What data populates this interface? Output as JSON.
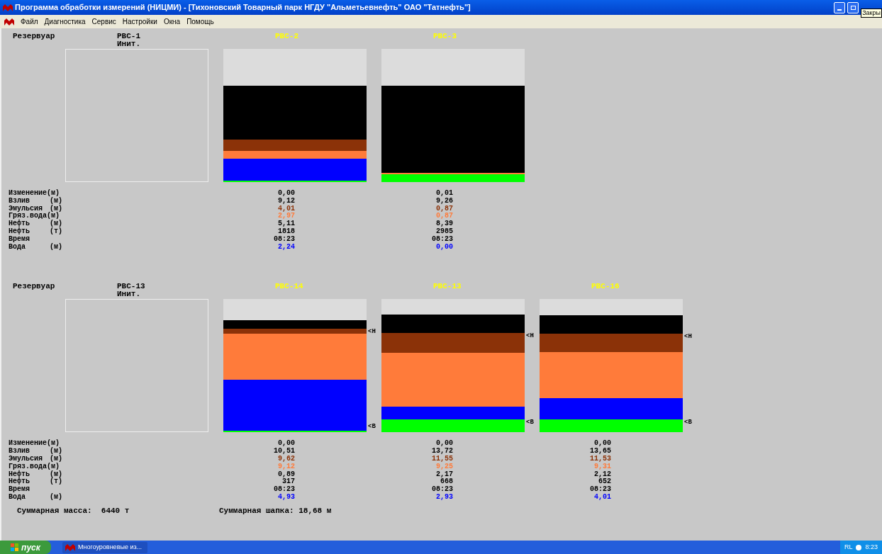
{
  "window": {
    "title": "Программа обработки измерений (НИЦМИ) - [Тихоновский Товарный парк НГДУ \"Альметьевнефть\" ОАО \"Татнефть\"]",
    "tooltip": "Закры"
  },
  "menu": [
    "Файл",
    "Диагностика",
    "Сервис",
    "Настройки",
    "Окна",
    "Помощь"
  ],
  "sections": [
    {
      "header_label": "Резервуар",
      "tanks": [
        {
          "kind": "init",
          "name": "РВС-1",
          "note": "Инит."
        },
        {
          "kind": "gauge",
          "name": "РВС-2",
          "layers": [
            {
              "kind": "empty"
            },
            {
              "kind": "oil"
            },
            {
              "kind": "emulsion"
            },
            {
              "kind": "dirty_water"
            },
            {
              "kind": "water"
            },
            {
              "kind": "bottom"
            }
          ]
        },
        {
          "kind": "gauge",
          "name": "РВС-3",
          "layers": [
            {
              "kind": "empty"
            },
            {
              "kind": "oil"
            },
            {
              "kind": "dirty_water"
            },
            {
              "kind": "bottom"
            }
          ]
        }
      ],
      "rows": [
        {
          "kind": "plain",
          "label": "Изменение(м)",
          "values": [
            "0,00",
            "0,01"
          ]
        },
        {
          "kind": "plain",
          "label": "Взлив",
          "unit": "(м)",
          "values": [
            "9,12",
            "9,26"
          ]
        },
        {
          "kind": "emulsion",
          "label": "Эмульсия",
          "unit": "(м)",
          "values": [
            "4,01",
            "0,87"
          ]
        },
        {
          "kind": "dirty_water",
          "label": "Гряз.вода(м)",
          "values": [
            "2,97",
            "0,87"
          ]
        },
        {
          "kind": "plain",
          "label": "Нефть",
          "unit": "(м)",
          "values": [
            "5,11",
            "8,39"
          ]
        },
        {
          "kind": "plain",
          "label": "Нефть",
          "unit": "(т)",
          "values": [
            "1818",
            "2985"
          ]
        },
        {
          "kind": "plain",
          "label": "Время",
          "values": [
            "08:23",
            "08:23"
          ]
        },
        {
          "kind": "water",
          "label": "Вода",
          "unit": "(м)",
          "values": [
            "2,24",
            "0,00"
          ]
        }
      ]
    },
    {
      "header_label": "Резервуар",
      "tanks": [
        {
          "kind": "init",
          "name": "РВС-13",
          "note": "Инит."
        },
        {
          "kind": "gauge",
          "name": "РВС-14",
          "layers": [
            {
              "kind": "empty"
            },
            {
              "kind": "oil"
            },
            {
              "kind": "emulsion",
              "marker": "<Н"
            },
            {
              "kind": "dirty_water"
            },
            {
              "kind": "water"
            },
            {
              "kind": "water",
              "marker": "<В"
            },
            {
              "kind": "bottom"
            }
          ]
        },
        {
          "kind": "gauge",
          "name": "РВС-13",
          "layers": [
            {
              "kind": "empty"
            },
            {
              "kind": "oil"
            },
            {
              "kind": "emulsion",
              "marker": "<Н"
            },
            {
              "kind": "dirty_water"
            },
            {
              "kind": "water"
            },
            {
              "kind": "bottom",
              "marker": "<В"
            }
          ]
        },
        {
          "kind": "gauge",
          "name": "РВС-16",
          "layers": [
            {
              "kind": "empty"
            },
            {
              "kind": "oil"
            },
            {
              "kind": "emulsion",
              "marker": "<Н"
            },
            {
              "kind": "dirty_water"
            },
            {
              "kind": "water"
            },
            {
              "kind": "bottom",
              "marker": "<В"
            }
          ]
        }
      ],
      "rows": [
        {
          "kind": "plain",
          "label": "Изменение(м)",
          "values": [
            "0,00",
            "0,00",
            "0,00"
          ]
        },
        {
          "kind": "plain",
          "label": "Взлив",
          "unit": "(м)",
          "values": [
            "10,51",
            "13,72",
            "13,65"
          ]
        },
        {
          "kind": "emulsion",
          "label": "Эмульсия",
          "unit": "(м)",
          "values": [
            "9,62",
            "11,55",
            "11,53"
          ]
        },
        {
          "kind": "dirty_water",
          "label": "Гряз.вода(м)",
          "values": [
            "9,12",
            "9,25",
            "9,31"
          ]
        },
        {
          "kind": "plain",
          "label": "Нефть",
          "unit": "(м)",
          "values": [
            "0,89",
            "2,17",
            "2,12"
          ]
        },
        {
          "kind": "plain",
          "label": "Нефть",
          "unit": "(т)",
          "values": [
            "317",
            "668",
            "652"
          ]
        },
        {
          "kind": "plain",
          "label": "Время",
          "values": [
            "08:23",
            "08:23",
            "08:23"
          ]
        },
        {
          "kind": "water",
          "label": "Вода",
          "unit": "(м)",
          "values": [
            "4,93",
            "2,93",
            "4,01"
          ]
        }
      ],
      "totals": [
        "Суммарная масса:  6440 т",
        "Суммарная шапка: 18,68 м"
      ]
    }
  ],
  "taskbar": {
    "start": "пуск",
    "task": "Многоуровневые из...",
    "lang": "RL",
    "clock": "8:23"
  }
}
